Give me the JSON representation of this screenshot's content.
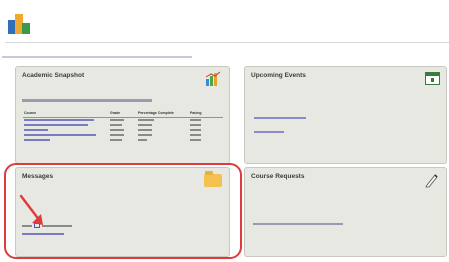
{
  "header": {
    "app_title": "",
    "intro_text": ""
  },
  "snapshot": {
    "title": "Academic Snapshot",
    "columns": [
      "Course",
      "Grade",
      "Percentage Complete",
      "Pacing"
    ],
    "rows": [
      {
        "course": "",
        "grade": "",
        "complete": "",
        "pacing": ""
      },
      {
        "course": "",
        "grade": "",
        "complete": "",
        "pacing": ""
      },
      {
        "course": "",
        "grade": "",
        "complete": "",
        "pacing": ""
      },
      {
        "course": "",
        "grade": "",
        "complete": "",
        "pacing": ""
      },
      {
        "course": "",
        "grade": "",
        "complete": "",
        "pacing": ""
      }
    ]
  },
  "events": {
    "title": "Upcoming Events"
  },
  "messages": {
    "title": "Messages"
  },
  "requests": {
    "title": "Course Requests"
  },
  "colors": {
    "highlight": "#e03a3a",
    "panel_bg": "#e8e8e3",
    "link": "#3b3bb0"
  },
  "icons": [
    "app-logo-icon",
    "chart-icon",
    "calendar-icon",
    "folder-icon",
    "pen-icon",
    "red-arrow-icon"
  ]
}
